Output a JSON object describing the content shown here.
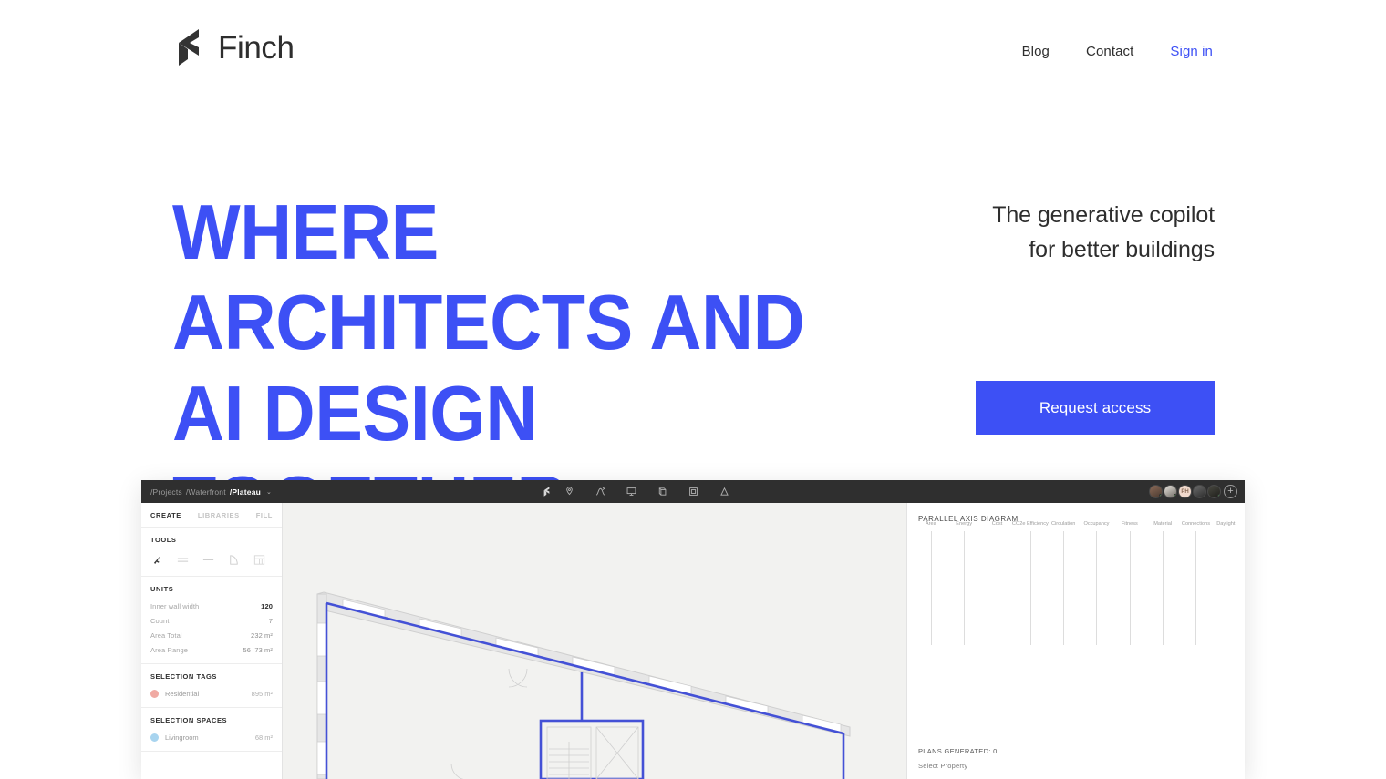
{
  "brand": {
    "name": "Finch",
    "logo_icon": "finch-chevron-logo"
  },
  "nav": [
    {
      "label": "Blog",
      "accent": false
    },
    {
      "label": "Contact",
      "accent": false
    },
    {
      "label": "Sign in",
      "accent": true
    }
  ],
  "hero": {
    "headline": "Where architects and AI design together.",
    "tagline_line1": "The generative copilot",
    "tagline_line2": "for better buildings",
    "cta_label": "Request access",
    "accent_color": "#3d50f5",
    "text_color": "#2e2e2e"
  },
  "app": {
    "topbar": {
      "breadcrumb_parts": [
        "/Projects",
        "/Waterfront"
      ],
      "breadcrumb_active": "/Plateau",
      "breadcrumb_chevron": "⌄",
      "tools": [
        "location-pin-icon",
        "path-curve-icon",
        "monitor-icon",
        "cube-icon",
        "building-window-icon",
        "triangle-icon"
      ],
      "avatars": [
        "user-1",
        "user-2",
        "PH",
        "user-4",
        "user-5"
      ],
      "add_user_label": "+"
    },
    "left_panel": {
      "tabs": [
        {
          "label": "CREATE",
          "active": true
        },
        {
          "label": "LIBRARIES",
          "active": false
        },
        {
          "label": "FILL",
          "active": false
        }
      ],
      "tools_title": "TOOLS",
      "tools": [
        "cursor-icon",
        "double-wall-icon",
        "single-line-icon",
        "curve-wall-icon",
        "grid-room-icon"
      ],
      "units_title": "UNITS",
      "units": [
        {
          "label": "Inner wall width",
          "value": "120",
          "strong": true
        },
        {
          "label": "Count",
          "value": "7",
          "strong": false
        },
        {
          "label": "Area Total",
          "value": "232 m²",
          "strong": false
        },
        {
          "label": "Area Range",
          "value": "56–73 m²",
          "strong": false
        }
      ],
      "selection_tags_title": "SELECTION TAGS",
      "selection_tags": [
        {
          "label": "Residential",
          "value": "895 m²",
          "color": "#f0aaa3"
        }
      ],
      "selection_spaces_title": "SELECTION SPACES",
      "selection_spaces": [
        {
          "label": "Livingroom",
          "value": "68 m²",
          "color": "#a8d4ef"
        }
      ]
    },
    "right_panel": {
      "title": "PARALLEL AXIS DIAGRAM",
      "axes": [
        "Area",
        "Energy",
        "Cost",
        "CO2e Efficiency",
        "Circulation",
        "Occupancy",
        "Fitness",
        "Material",
        "Connections",
        "Daylight"
      ],
      "plans_generated": "PLANS GENERATED: 0",
      "select_property": "Select Property"
    },
    "canvas": {
      "wall_color": "#3d50f5",
      "fill_color": "#ffffff",
      "background": "#f2f2f0"
    }
  }
}
